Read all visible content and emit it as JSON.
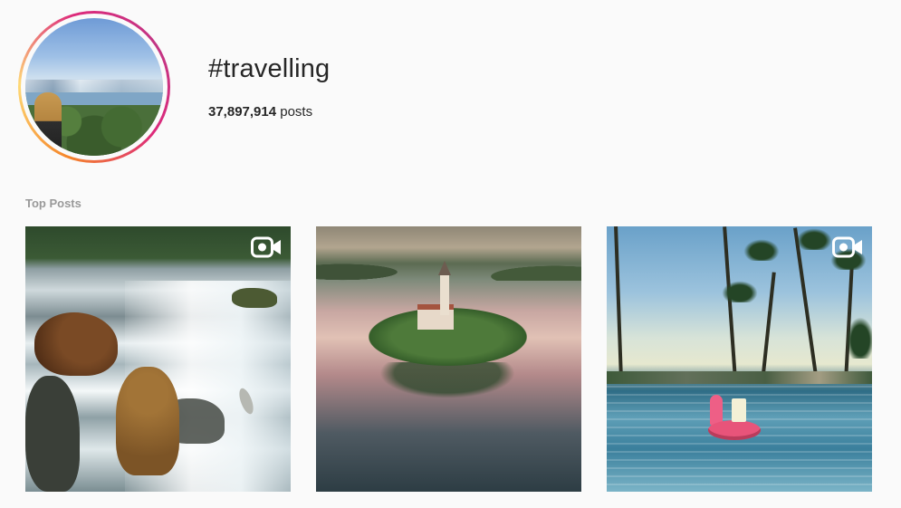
{
  "header": {
    "hashtag": "#travelling",
    "post_count": "37,897,914",
    "post_count_suffix": "posts"
  },
  "sections": {
    "top_posts_label": "Top Posts"
  },
  "posts": [
    {
      "icon": "video-icon",
      "is_video": true
    },
    {
      "icon": null,
      "is_video": false
    },
    {
      "icon": "video-icon",
      "is_video": true
    }
  ],
  "colors": {
    "background": "#fafafa",
    "text": "#262626",
    "muted": "#999999",
    "ring_gradient": [
      "#f58529",
      "#dd2a7b",
      "#c13584"
    ]
  }
}
